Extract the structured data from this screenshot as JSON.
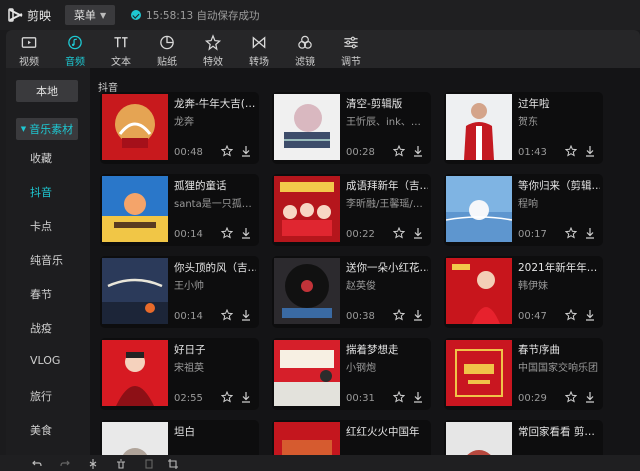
{
  "app": {
    "title": "剪映"
  },
  "titlebar": {
    "menu_label": "菜单",
    "status": "15:58:13 自动保存成功"
  },
  "toolbar": [
    {
      "label": "视频",
      "icon": "video-icon"
    },
    {
      "label": "音频",
      "icon": "audio-icon",
      "active": true
    },
    {
      "label": "文本",
      "icon": "text-icon"
    },
    {
      "label": "贴纸",
      "icon": "sticker-icon"
    },
    {
      "label": "特效",
      "icon": "effects-icon"
    },
    {
      "label": "转场",
      "icon": "transition-icon"
    },
    {
      "label": "滤镜",
      "icon": "filter-icon"
    },
    {
      "label": "调节",
      "icon": "adjust-icon"
    }
  ],
  "sidebar": {
    "local": "本地",
    "category": "音乐素材",
    "items": [
      "收藏",
      "抖音",
      "卡点",
      "纯音乐",
      "春节",
      "战疫",
      "VLOG",
      "旅行",
      "美食"
    ],
    "active_index": 1
  },
  "section_title": "抖音",
  "tracks": [
    {
      "title": "龙奔-牛年大吉(…",
      "artist": "龙奔",
      "duration": "00:48"
    },
    {
      "title": "清空-剪辑版",
      "artist": "王忻辰、ink、…",
      "duration": "00:28"
    },
    {
      "title": "过年啦",
      "artist": "贺东",
      "duration": "01:43"
    },
    {
      "title": "孤狸的童话",
      "artist": "santa是一只孤…",
      "duration": "00:14"
    },
    {
      "title": "成语拜新年（吉…",
      "artist": "李昕融/王馨瑶/…",
      "duration": "00:22"
    },
    {
      "title": "等你归来（剪辑…",
      "artist": "程响",
      "duration": "00:17"
    },
    {
      "title": "你头顶的风（吉…",
      "artist": "王小帅",
      "duration": "00:14"
    },
    {
      "title": "送你一朵小红花…",
      "artist": "赵英俊",
      "duration": "00:38"
    },
    {
      "title": "2021年新年年…",
      "artist": "韩伊妹",
      "duration": "00:47"
    },
    {
      "title": "好日子",
      "artist": "宋祖英",
      "duration": "02:55"
    },
    {
      "title": "揣着梦想走",
      "artist": "小钢炮",
      "duration": "00:31"
    },
    {
      "title": "春节序曲",
      "artist": "中国国家交响乐团",
      "duration": "00:29"
    },
    {
      "title": "坦白",
      "artist": "",
      "duration": ""
    },
    {
      "title": "红红火火中国年",
      "artist": "",
      "duration": ""
    },
    {
      "title": "常回家看看 剪…",
      "artist": "",
      "duration": ""
    }
  ]
}
